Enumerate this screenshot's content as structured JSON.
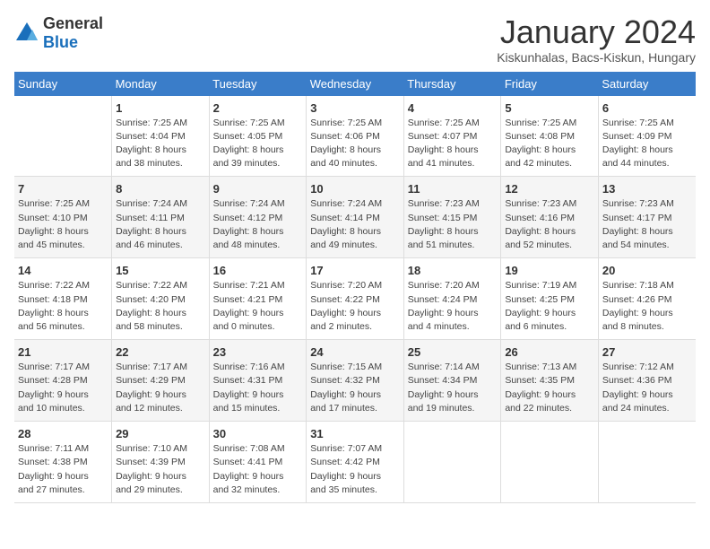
{
  "logo": {
    "general": "General",
    "blue": "Blue"
  },
  "header": {
    "month_title": "January 2024",
    "location": "Kiskunhalas, Bacs-Kiskun, Hungary"
  },
  "weekdays": [
    "Sunday",
    "Monday",
    "Tuesday",
    "Wednesday",
    "Thursday",
    "Friday",
    "Saturday"
  ],
  "weeks": [
    [
      {
        "day": "",
        "info": ""
      },
      {
        "day": "1",
        "info": "Sunrise: 7:25 AM\nSunset: 4:04 PM\nDaylight: 8 hours\nand 38 minutes."
      },
      {
        "day": "2",
        "info": "Sunrise: 7:25 AM\nSunset: 4:05 PM\nDaylight: 8 hours\nand 39 minutes."
      },
      {
        "day": "3",
        "info": "Sunrise: 7:25 AM\nSunset: 4:06 PM\nDaylight: 8 hours\nand 40 minutes."
      },
      {
        "day": "4",
        "info": "Sunrise: 7:25 AM\nSunset: 4:07 PM\nDaylight: 8 hours\nand 41 minutes."
      },
      {
        "day": "5",
        "info": "Sunrise: 7:25 AM\nSunset: 4:08 PM\nDaylight: 8 hours\nand 42 minutes."
      },
      {
        "day": "6",
        "info": "Sunrise: 7:25 AM\nSunset: 4:09 PM\nDaylight: 8 hours\nand 44 minutes."
      }
    ],
    [
      {
        "day": "7",
        "info": "Sunrise: 7:25 AM\nSunset: 4:10 PM\nDaylight: 8 hours\nand 45 minutes."
      },
      {
        "day": "8",
        "info": "Sunrise: 7:24 AM\nSunset: 4:11 PM\nDaylight: 8 hours\nand 46 minutes."
      },
      {
        "day": "9",
        "info": "Sunrise: 7:24 AM\nSunset: 4:12 PM\nDaylight: 8 hours\nand 48 minutes."
      },
      {
        "day": "10",
        "info": "Sunrise: 7:24 AM\nSunset: 4:14 PM\nDaylight: 8 hours\nand 49 minutes."
      },
      {
        "day": "11",
        "info": "Sunrise: 7:23 AM\nSunset: 4:15 PM\nDaylight: 8 hours\nand 51 minutes."
      },
      {
        "day": "12",
        "info": "Sunrise: 7:23 AM\nSunset: 4:16 PM\nDaylight: 8 hours\nand 52 minutes."
      },
      {
        "day": "13",
        "info": "Sunrise: 7:23 AM\nSunset: 4:17 PM\nDaylight: 8 hours\nand 54 minutes."
      }
    ],
    [
      {
        "day": "14",
        "info": "Sunrise: 7:22 AM\nSunset: 4:18 PM\nDaylight: 8 hours\nand 56 minutes."
      },
      {
        "day": "15",
        "info": "Sunrise: 7:22 AM\nSunset: 4:20 PM\nDaylight: 8 hours\nand 58 minutes."
      },
      {
        "day": "16",
        "info": "Sunrise: 7:21 AM\nSunset: 4:21 PM\nDaylight: 9 hours\nand 0 minutes."
      },
      {
        "day": "17",
        "info": "Sunrise: 7:20 AM\nSunset: 4:22 PM\nDaylight: 9 hours\nand 2 minutes."
      },
      {
        "day": "18",
        "info": "Sunrise: 7:20 AM\nSunset: 4:24 PM\nDaylight: 9 hours\nand 4 minutes."
      },
      {
        "day": "19",
        "info": "Sunrise: 7:19 AM\nSunset: 4:25 PM\nDaylight: 9 hours\nand 6 minutes."
      },
      {
        "day": "20",
        "info": "Sunrise: 7:18 AM\nSunset: 4:26 PM\nDaylight: 9 hours\nand 8 minutes."
      }
    ],
    [
      {
        "day": "21",
        "info": "Sunrise: 7:17 AM\nSunset: 4:28 PM\nDaylight: 9 hours\nand 10 minutes."
      },
      {
        "day": "22",
        "info": "Sunrise: 7:17 AM\nSunset: 4:29 PM\nDaylight: 9 hours\nand 12 minutes."
      },
      {
        "day": "23",
        "info": "Sunrise: 7:16 AM\nSunset: 4:31 PM\nDaylight: 9 hours\nand 15 minutes."
      },
      {
        "day": "24",
        "info": "Sunrise: 7:15 AM\nSunset: 4:32 PM\nDaylight: 9 hours\nand 17 minutes."
      },
      {
        "day": "25",
        "info": "Sunrise: 7:14 AM\nSunset: 4:34 PM\nDaylight: 9 hours\nand 19 minutes."
      },
      {
        "day": "26",
        "info": "Sunrise: 7:13 AM\nSunset: 4:35 PM\nDaylight: 9 hours\nand 22 minutes."
      },
      {
        "day": "27",
        "info": "Sunrise: 7:12 AM\nSunset: 4:36 PM\nDaylight: 9 hours\nand 24 minutes."
      }
    ],
    [
      {
        "day": "28",
        "info": "Sunrise: 7:11 AM\nSunset: 4:38 PM\nDaylight: 9 hours\nand 27 minutes."
      },
      {
        "day": "29",
        "info": "Sunrise: 7:10 AM\nSunset: 4:39 PM\nDaylight: 9 hours\nand 29 minutes."
      },
      {
        "day": "30",
        "info": "Sunrise: 7:08 AM\nSunset: 4:41 PM\nDaylight: 9 hours\nand 32 minutes."
      },
      {
        "day": "31",
        "info": "Sunrise: 7:07 AM\nSunset: 4:42 PM\nDaylight: 9 hours\nand 35 minutes."
      },
      {
        "day": "",
        "info": ""
      },
      {
        "day": "",
        "info": ""
      },
      {
        "day": "",
        "info": ""
      }
    ]
  ]
}
